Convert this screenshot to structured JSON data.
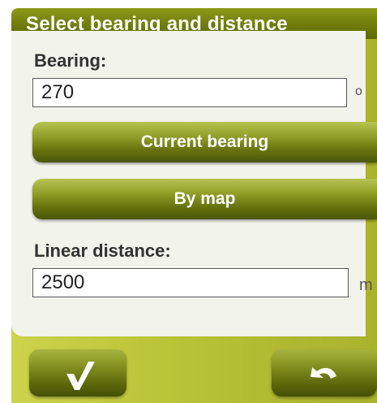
{
  "dialog": {
    "title": "Select bearing and distance"
  },
  "bearing": {
    "label": "Bearing:",
    "value": "270",
    "unit": "o"
  },
  "buttons": {
    "current_bearing": "Current bearing",
    "by_map": "By map"
  },
  "distance": {
    "label": "Linear distance:",
    "value": "2500",
    "unit": "m"
  },
  "actions": {
    "confirm_icon": "checkmark-icon",
    "back_icon": "undo-arrow-icon"
  },
  "colors": {
    "title_bar": "#6f7c0c",
    "frame": "#b9c336",
    "panel": "#f2f3ea",
    "button": "#66720d"
  }
}
